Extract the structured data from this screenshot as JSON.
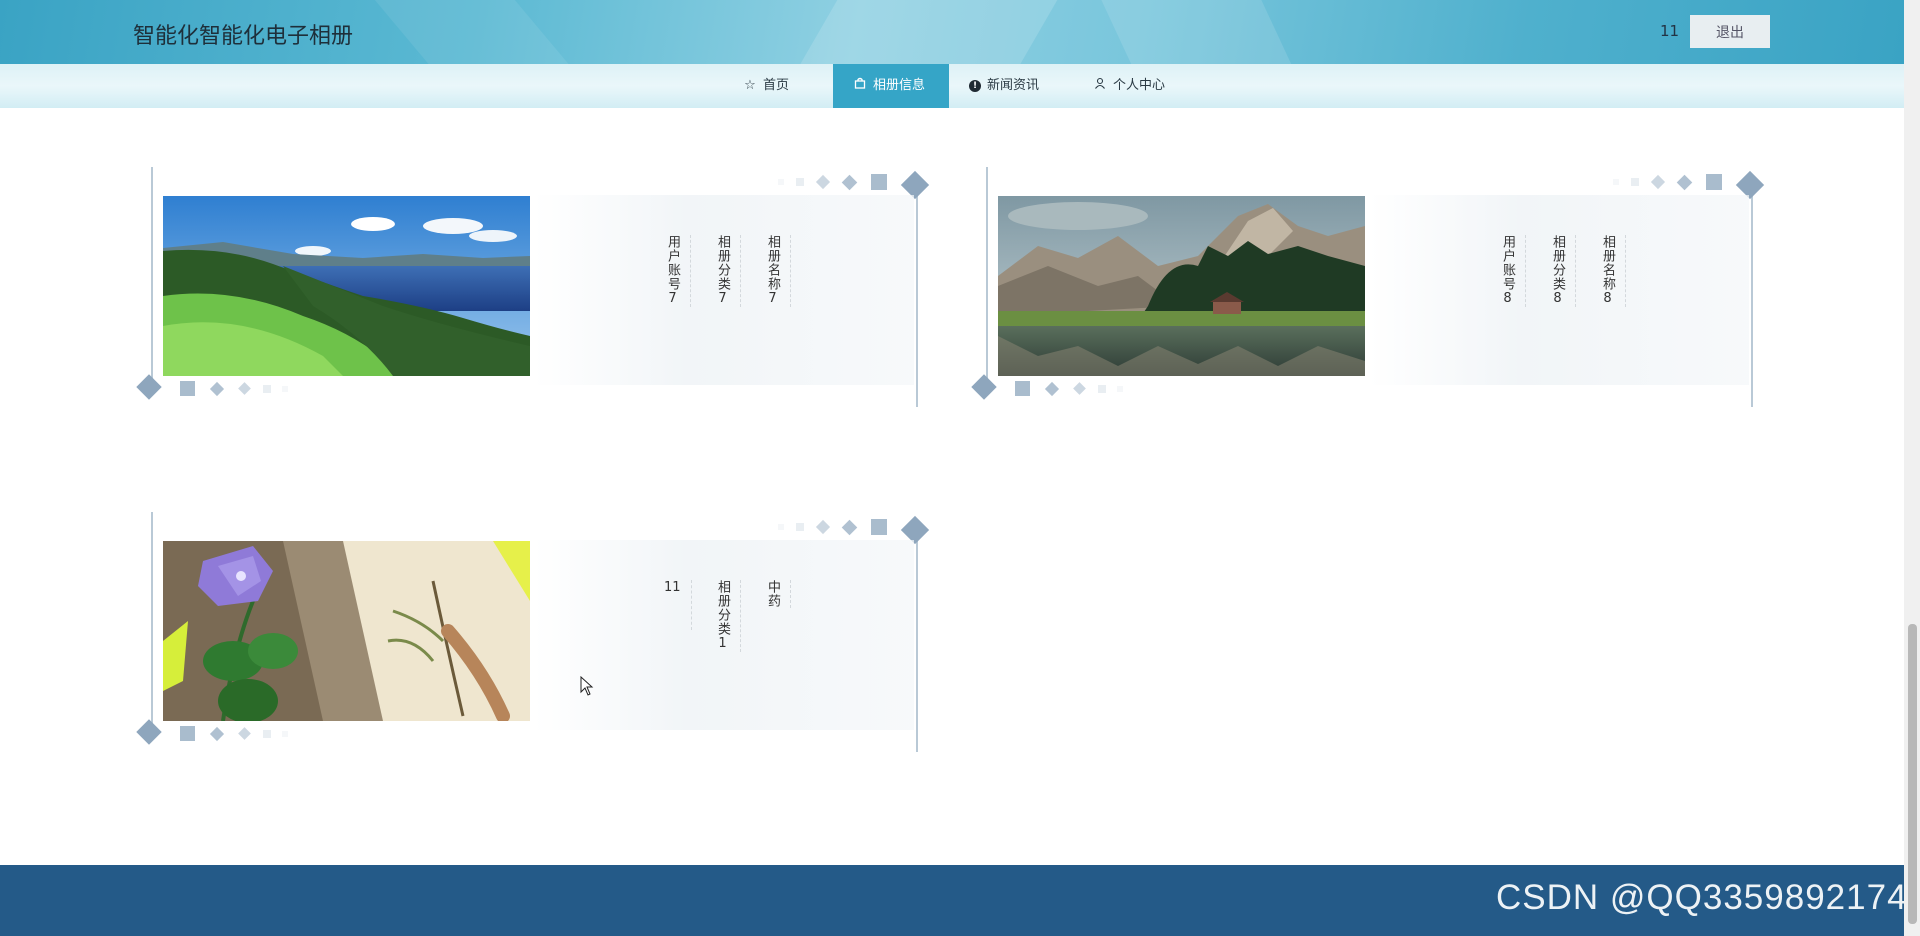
{
  "header": {
    "title": "智能化智能化电子相册",
    "username": "11",
    "logout_label": "退出"
  },
  "nav": {
    "items": [
      {
        "label": "首页",
        "icon": "star-icon"
      },
      {
        "label": "相册信息",
        "icon": "bag-icon",
        "active": true
      },
      {
        "label": "新闻资讯",
        "icon": "info-icon"
      },
      {
        "label": "个人中心",
        "icon": "user-icon"
      }
    ]
  },
  "albums": [
    {
      "photo": "lake-hills-photo",
      "user": "用户账号7",
      "category": "相册分类7",
      "name": "相册名称7"
    },
    {
      "photo": "mountain-lake-cabin-photo",
      "user": "用户账号8",
      "category": "相册分类8",
      "name": "相册名称8"
    },
    {
      "photo": "bellflower-herb-photo",
      "user": "11",
      "category": "相册分类1",
      "name": "中药"
    }
  ],
  "watermark": "CSDN @QQ3359892174",
  "colors": {
    "header_accent": "#3aa3c4",
    "nav_active": "#35a5c7",
    "footer": "#245a88",
    "decor": "#8ea6bd"
  }
}
